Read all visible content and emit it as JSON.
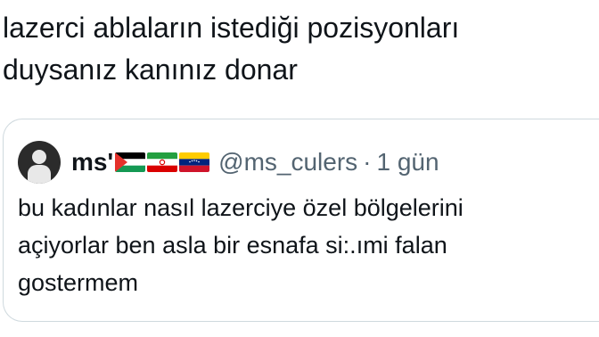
{
  "tweet": {
    "text": "lazerci ablaların istediği pozisyonları\nduysanız kanınız donar"
  },
  "quote": {
    "display_name": "ms'",
    "flags": [
      "palestine-flag-icon",
      "iran-flag-icon",
      "venezuela-flag-icon"
    ],
    "handle": "@ms_culers",
    "separator": "·",
    "time": "1 gün",
    "text": "bu kadınlar nasıl lazerciye özel bölgelerini\naçiyorlar ben asla bir esnafa si:.ımi falan\ngostermem"
  },
  "colors": {
    "text": "#0f1419",
    "secondary": "#536471",
    "border": "#cfd9de"
  }
}
